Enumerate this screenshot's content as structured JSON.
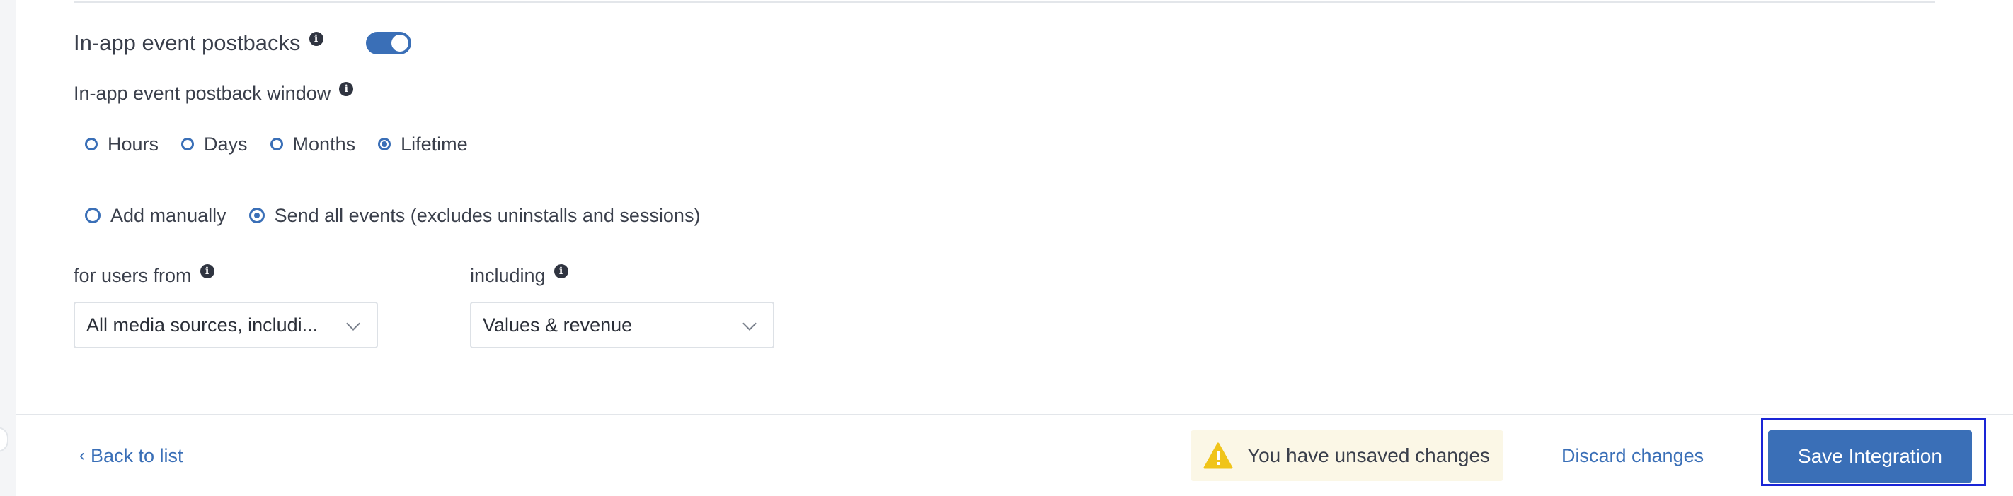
{
  "postbacks": {
    "title": "In-app event postbacks",
    "toggle_on": true
  },
  "window": {
    "label": "In-app event postback window",
    "options": [
      {
        "label": "Hours",
        "checked": false
      },
      {
        "label": "Days",
        "checked": false
      },
      {
        "label": "Months",
        "checked": false
      },
      {
        "label": "Lifetime",
        "checked": true
      }
    ]
  },
  "events_mode": {
    "options": [
      {
        "label": "Add manually",
        "checked": false
      },
      {
        "label": "Send all events (excludes uninstalls and sessions)",
        "checked": true
      }
    ]
  },
  "users_from": {
    "label": "for users from",
    "value": "All media sources, includi..."
  },
  "including": {
    "label": "including",
    "value": "Values & revenue"
  },
  "footer": {
    "back_label": "Back to list",
    "warning_text": "You have unsaved changes",
    "discard_label": "Discard changes",
    "save_label": "Save Integration"
  },
  "colors": {
    "accent": "#3a6fb7",
    "warning_bg": "#fbf7e6",
    "warning_icon": "#f0c419",
    "highlight_outline": "#1a25d6"
  }
}
